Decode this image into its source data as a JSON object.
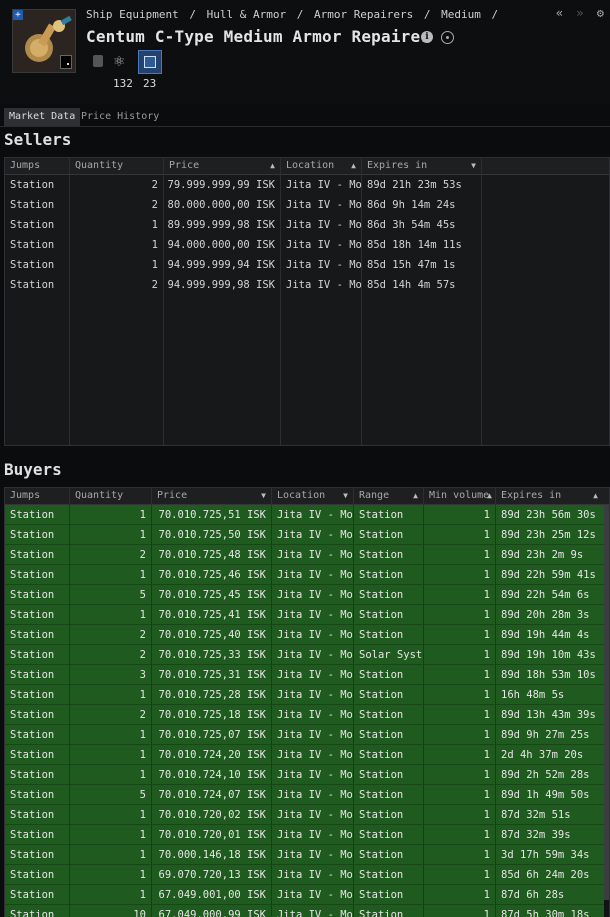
{
  "header": {
    "breadcrumb": [
      "Ship Equipment",
      "/",
      "Hull & Armor",
      "/",
      "Armor Repairers",
      "/",
      "Medium",
      "/"
    ],
    "title": "Centum C-Type Medium Armor Repairer",
    "counts": [
      "132",
      "23"
    ],
    "nav": [
      "«",
      "»",
      "⚙"
    ]
  },
  "tabs": [
    {
      "label": "Market Data",
      "active": true
    },
    {
      "label": "Price History",
      "active": false
    }
  ],
  "sellers": {
    "title": "Sellers",
    "columns": [
      "Jumps",
      "Quantity",
      "Price",
      "Location",
      "Expires in"
    ],
    "rows": [
      [
        "Station",
        "2",
        "79.999.999,99 ISK",
        "Jita IV - Mo",
        "89d 21h 23m 53s"
      ],
      [
        "Station",
        "2",
        "80.000.000,00 ISK",
        "Jita IV - Mo",
        "86d 9h 14m 24s"
      ],
      [
        "Station",
        "1",
        "89.999.999,98 ISK",
        "Jita IV - Mo",
        "86d 3h 54m 45s"
      ],
      [
        "Station",
        "1",
        "94.000.000,00 ISK",
        "Jita IV - Mo",
        "85d 18h 14m 11s"
      ],
      [
        "Station",
        "1",
        "94.999.999,94 ISK",
        "Jita IV - Mo",
        "85d 15h 47m 1s"
      ],
      [
        "Station",
        "2",
        "94.999.999,98 ISK",
        "Jita IV - Mo",
        "85d 14h 4m 57s"
      ]
    ]
  },
  "buyers": {
    "title": "Buyers",
    "columns": [
      "Jumps",
      "Quantity",
      "Price",
      "Location",
      "Range",
      "Min volume",
      "Expires in"
    ],
    "rows": [
      [
        "Station",
        "1",
        "70.010.725,51 ISK",
        "Jita IV - Mo",
        "Station",
        "1",
        "89d 23h 56m 30s"
      ],
      [
        "Station",
        "1",
        "70.010.725,50 ISK",
        "Jita IV - Mo",
        "Station",
        "1",
        "89d 23h 25m 12s"
      ],
      [
        "Station",
        "2",
        "70.010.725,48 ISK",
        "Jita IV - Mo",
        "Station",
        "1",
        "89d 23h 2m 9s"
      ],
      [
        "Station",
        "1",
        "70.010.725,46 ISK",
        "Jita IV - Mo",
        "Station",
        "1",
        "89d 22h 59m 41s"
      ],
      [
        "Station",
        "5",
        "70.010.725,45 ISK",
        "Jita IV - Mo",
        "Station",
        "1",
        "89d 22h 54m 6s"
      ],
      [
        "Station",
        "1",
        "70.010.725,41 ISK",
        "Jita IV - Mo",
        "Station",
        "1",
        "89d 20h 28m 3s"
      ],
      [
        "Station",
        "2",
        "70.010.725,40 ISK",
        "Jita IV - Mo",
        "Station",
        "1",
        "89d 19h 44m 4s"
      ],
      [
        "Station",
        "2",
        "70.010.725,33 ISK",
        "Jita IV - Mo",
        "Solar Syst",
        "1",
        "89d 19h 10m 43s"
      ],
      [
        "Station",
        "3",
        "70.010.725,31 ISK",
        "Jita IV - Mo",
        "Station",
        "1",
        "89d 18h 53m 10s"
      ],
      [
        "Station",
        "1",
        "70.010.725,28 ISK",
        "Jita IV - Mo",
        "Station",
        "1",
        "16h 48m 5s"
      ],
      [
        "Station",
        "2",
        "70.010.725,18 ISK",
        "Jita IV - Mo",
        "Station",
        "1",
        "89d 13h 43m 39s"
      ],
      [
        "Station",
        "1",
        "70.010.725,07 ISK",
        "Jita IV - Mo",
        "Station",
        "1",
        "89d 9h 27m 25s"
      ],
      [
        "Station",
        "1",
        "70.010.724,20 ISK",
        "Jita IV - Mo",
        "Station",
        "1",
        "2d 4h 37m 20s"
      ],
      [
        "Station",
        "1",
        "70.010.724,10 ISK",
        "Jita IV - Mo",
        "Station",
        "1",
        "89d 2h 52m 28s"
      ],
      [
        "Station",
        "5",
        "70.010.724,07 ISK",
        "Jita IV - Mo",
        "Station",
        "1",
        "89d 1h 49m 50s"
      ],
      [
        "Station",
        "1",
        "70.010.720,02 ISK",
        "Jita IV - Mo",
        "Station",
        "1",
        "87d 32m 51s"
      ],
      [
        "Station",
        "1",
        "70.010.720,01 ISK",
        "Jita IV - Mo",
        "Station",
        "1",
        "87d 32m 39s"
      ],
      [
        "Station",
        "1",
        "70.000.146,18 ISK",
        "Jita IV - Mo",
        "Station",
        "1",
        "3d 17h 59m 34s"
      ],
      [
        "Station",
        "1",
        "69.070.720,13 ISK",
        "Jita IV - Mo",
        "Station",
        "1",
        "85d 6h 24m 20s"
      ],
      [
        "Station",
        "1",
        "67.049.001,00 ISK",
        "Jita IV - Mo",
        "Station",
        "1",
        "87d 6h 28s"
      ],
      [
        "Station",
        "10",
        "67.049.000,99 ISK",
        "Jita IV - Mo",
        "Station",
        "1",
        "87d 5h 30m 18s"
      ]
    ]
  }
}
